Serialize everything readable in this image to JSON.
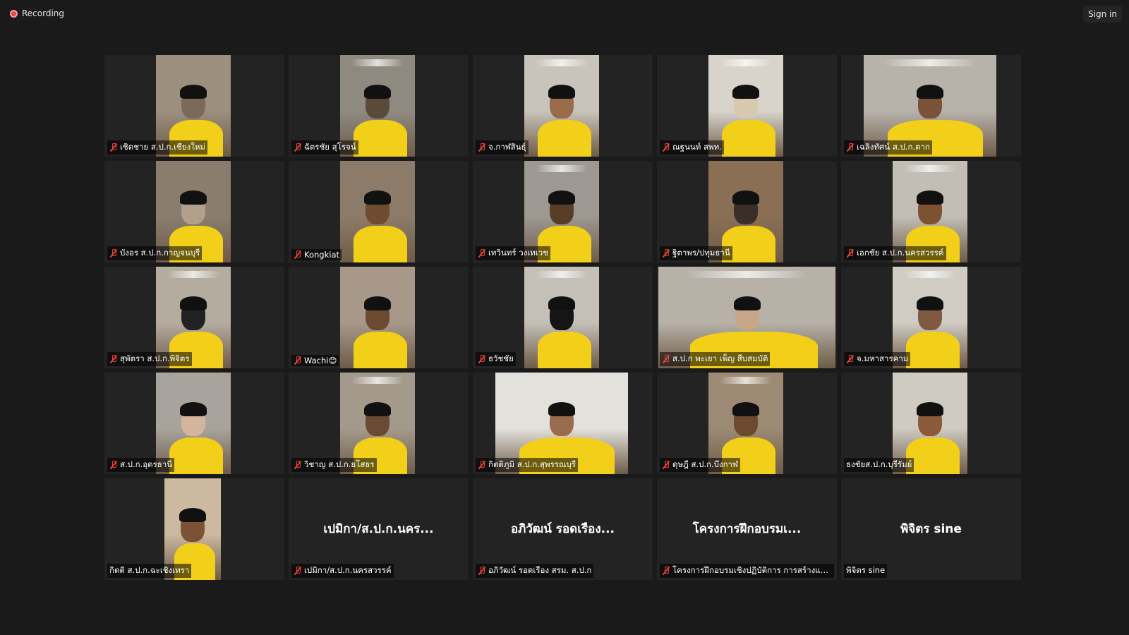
{
  "recording_label": "Recording",
  "sign_in_label": "Sign in",
  "participants": [
    {
      "label": "เชิดชาย ส.ป.ก.เชียงใหม่",
      "muted": true,
      "video": true
    },
    {
      "label": "ฉัตรชัย สุโรจน์",
      "muted": true,
      "video": true
    },
    {
      "label": "จ.กาฬสินธุ์",
      "muted": true,
      "video": true
    },
    {
      "label": "ณฐนนท์ สพท.",
      "muted": true,
      "video": true
    },
    {
      "label": "เฉลิงทัศน์ ส.ป.ก.ตาก",
      "muted": true,
      "video": true
    },
    {
      "label": "บังอร ส.ป.ก.กาญจนบุรี",
      "muted": true,
      "video": true
    },
    {
      "label": "Kongkiat",
      "muted": true,
      "video": true
    },
    {
      "label": "เทวินทร์ วงเทเวช",
      "muted": true,
      "video": true
    },
    {
      "label": "ฐิตาพร/ปทุมธานี",
      "muted": true,
      "video": true
    },
    {
      "label": "เอกชัย ส.ป.ก.นครสวรรค์",
      "muted": true,
      "video": true
    },
    {
      "label": "สุพัตรา ส.ป.ก.พิจิตร",
      "muted": true,
      "video": true
    },
    {
      "label": "Wachi😊",
      "muted": true,
      "video": true
    },
    {
      "label": "ธวัชชัย",
      "muted": true,
      "video": true
    },
    {
      "label": "ส.ป.ก พะเยา เพ็ญ สืบสมบัติ",
      "muted": true,
      "video": true
    },
    {
      "label": "จ.มหาสารคาม",
      "muted": true,
      "video": true
    },
    {
      "label": "ส.ป.ก.อุดรธานี",
      "muted": true,
      "video": true
    },
    {
      "label": "วิชาญ ส.ป.ก.ยโสธร",
      "muted": true,
      "video": true
    },
    {
      "label": "กิตติภูมิ ส.ป.ก.สุพรรณบุรี",
      "muted": true,
      "video": true
    },
    {
      "label": "ดุษฎี ส.ป.ก.บึงกาฬ",
      "muted": true,
      "video": true
    },
    {
      "label": "ธงชัยส.ป.ก.บุรีรัมย์",
      "muted": false,
      "video": true
    },
    {
      "label": "กิตติ ส.ป.ก.ฉะเชิงเทรา",
      "muted": false,
      "video": true
    },
    {
      "label": "เปมิกา/ส.ป.ก.นครสวรรค์",
      "display_name": "เปมิกา/ส.ป.ก.นคร...",
      "muted": true,
      "video": false
    },
    {
      "label": "อภิวัฒน์ รอดเรือง สรม. ส.ป.ก",
      "display_name": "อภิวัฒน์ รอดเรือง...",
      "muted": true,
      "video": false
    },
    {
      "label": "โครงการฝึกอบรมเชิงปฏิบัติการ การสร้างและพั...",
      "display_name": "โครงการฝึกอบรมเ...",
      "muted": true,
      "video": false
    },
    {
      "label": "พิจิตร sine",
      "display_name": "พิจิตร sine",
      "muted": false,
      "video": false
    }
  ],
  "colors": {
    "background": "#1a1a1a",
    "tile": "#232323",
    "muted_icon": "#e8433a",
    "shirt": "#f2cf18"
  }
}
